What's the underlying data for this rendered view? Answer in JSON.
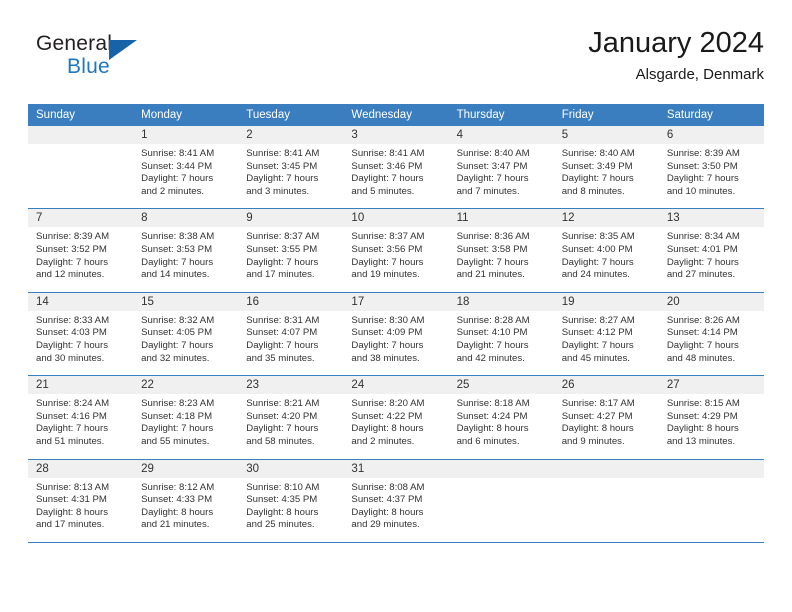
{
  "brand": {
    "name_part1": "General",
    "name_part2": "Blue",
    "triangle_color": "#1863a8",
    "blue_color": "#1f77c2"
  },
  "header": {
    "month_title": "January 2024",
    "location": "Alsgarde, Denmark"
  },
  "theme": {
    "header_bar_color": "#3a7ebf",
    "daynum_band_color": "#f0f0f0",
    "separator_color": "#3a7ebf",
    "text_color": "#333333"
  },
  "labels": {
    "sunrise_prefix": "Sunrise:",
    "sunset_prefix": "Sunset:",
    "daylight_prefix": "Daylight:"
  },
  "weekdays": [
    "Sunday",
    "Monday",
    "Tuesday",
    "Wednesday",
    "Thursday",
    "Friday",
    "Saturday"
  ],
  "weeks": [
    [
      {
        "day": "",
        "empty": true
      },
      {
        "day": "1",
        "sunrise": "Sunrise: 8:41 AM",
        "sunset": "Sunset: 3:44 PM",
        "daylight": "Daylight: 7 hours and 2 minutes."
      },
      {
        "day": "2",
        "sunrise": "Sunrise: 8:41 AM",
        "sunset": "Sunset: 3:45 PM",
        "daylight": "Daylight: 7 hours and 3 minutes."
      },
      {
        "day": "3",
        "sunrise": "Sunrise: 8:41 AM",
        "sunset": "Sunset: 3:46 PM",
        "daylight": "Daylight: 7 hours and 5 minutes."
      },
      {
        "day": "4",
        "sunrise": "Sunrise: 8:40 AM",
        "sunset": "Sunset: 3:47 PM",
        "daylight": "Daylight: 7 hours and 7 minutes."
      },
      {
        "day": "5",
        "sunrise": "Sunrise: 8:40 AM",
        "sunset": "Sunset: 3:49 PM",
        "daylight": "Daylight: 7 hours and 8 minutes."
      },
      {
        "day": "6",
        "sunrise": "Sunrise: 8:39 AM",
        "sunset": "Sunset: 3:50 PM",
        "daylight": "Daylight: 7 hours and 10 minutes."
      }
    ],
    [
      {
        "day": "7",
        "sunrise": "Sunrise: 8:39 AM",
        "sunset": "Sunset: 3:52 PM",
        "daylight": "Daylight: 7 hours and 12 minutes."
      },
      {
        "day": "8",
        "sunrise": "Sunrise: 8:38 AM",
        "sunset": "Sunset: 3:53 PM",
        "daylight": "Daylight: 7 hours and 14 minutes."
      },
      {
        "day": "9",
        "sunrise": "Sunrise: 8:37 AM",
        "sunset": "Sunset: 3:55 PM",
        "daylight": "Daylight: 7 hours and 17 minutes."
      },
      {
        "day": "10",
        "sunrise": "Sunrise: 8:37 AM",
        "sunset": "Sunset: 3:56 PM",
        "daylight": "Daylight: 7 hours and 19 minutes."
      },
      {
        "day": "11",
        "sunrise": "Sunrise: 8:36 AM",
        "sunset": "Sunset: 3:58 PM",
        "daylight": "Daylight: 7 hours and 21 minutes."
      },
      {
        "day": "12",
        "sunrise": "Sunrise: 8:35 AM",
        "sunset": "Sunset: 4:00 PM",
        "daylight": "Daylight: 7 hours and 24 minutes."
      },
      {
        "day": "13",
        "sunrise": "Sunrise: 8:34 AM",
        "sunset": "Sunset: 4:01 PM",
        "daylight": "Daylight: 7 hours and 27 minutes."
      }
    ],
    [
      {
        "day": "14",
        "sunrise": "Sunrise: 8:33 AM",
        "sunset": "Sunset: 4:03 PM",
        "daylight": "Daylight: 7 hours and 30 minutes."
      },
      {
        "day": "15",
        "sunrise": "Sunrise: 8:32 AM",
        "sunset": "Sunset: 4:05 PM",
        "daylight": "Daylight: 7 hours and 32 minutes."
      },
      {
        "day": "16",
        "sunrise": "Sunrise: 8:31 AM",
        "sunset": "Sunset: 4:07 PM",
        "daylight": "Daylight: 7 hours and 35 minutes."
      },
      {
        "day": "17",
        "sunrise": "Sunrise: 8:30 AM",
        "sunset": "Sunset: 4:09 PM",
        "daylight": "Daylight: 7 hours and 38 minutes."
      },
      {
        "day": "18",
        "sunrise": "Sunrise: 8:28 AM",
        "sunset": "Sunset: 4:10 PM",
        "daylight": "Daylight: 7 hours and 42 minutes."
      },
      {
        "day": "19",
        "sunrise": "Sunrise: 8:27 AM",
        "sunset": "Sunset: 4:12 PM",
        "daylight": "Daylight: 7 hours and 45 minutes."
      },
      {
        "day": "20",
        "sunrise": "Sunrise: 8:26 AM",
        "sunset": "Sunset: 4:14 PM",
        "daylight": "Daylight: 7 hours and 48 minutes."
      }
    ],
    [
      {
        "day": "21",
        "sunrise": "Sunrise: 8:24 AM",
        "sunset": "Sunset: 4:16 PM",
        "daylight": "Daylight: 7 hours and 51 minutes."
      },
      {
        "day": "22",
        "sunrise": "Sunrise: 8:23 AM",
        "sunset": "Sunset: 4:18 PM",
        "daylight": "Daylight: 7 hours and 55 minutes."
      },
      {
        "day": "23",
        "sunrise": "Sunrise: 8:21 AM",
        "sunset": "Sunset: 4:20 PM",
        "daylight": "Daylight: 7 hours and 58 minutes."
      },
      {
        "day": "24",
        "sunrise": "Sunrise: 8:20 AM",
        "sunset": "Sunset: 4:22 PM",
        "daylight": "Daylight: 8 hours and 2 minutes."
      },
      {
        "day": "25",
        "sunrise": "Sunrise: 8:18 AM",
        "sunset": "Sunset: 4:24 PM",
        "daylight": "Daylight: 8 hours and 6 minutes."
      },
      {
        "day": "26",
        "sunrise": "Sunrise: 8:17 AM",
        "sunset": "Sunset: 4:27 PM",
        "daylight": "Daylight: 8 hours and 9 minutes."
      },
      {
        "day": "27",
        "sunrise": "Sunrise: 8:15 AM",
        "sunset": "Sunset: 4:29 PM",
        "daylight": "Daylight: 8 hours and 13 minutes."
      }
    ],
    [
      {
        "day": "28",
        "sunrise": "Sunrise: 8:13 AM",
        "sunset": "Sunset: 4:31 PM",
        "daylight": "Daylight: 8 hours and 17 minutes."
      },
      {
        "day": "29",
        "sunrise": "Sunrise: 8:12 AM",
        "sunset": "Sunset: 4:33 PM",
        "daylight": "Daylight: 8 hours and 21 minutes."
      },
      {
        "day": "30",
        "sunrise": "Sunrise: 8:10 AM",
        "sunset": "Sunset: 4:35 PM",
        "daylight": "Daylight: 8 hours and 25 minutes."
      },
      {
        "day": "31",
        "sunrise": "Sunrise: 8:08 AM",
        "sunset": "Sunset: 4:37 PM",
        "daylight": "Daylight: 8 hours and 29 minutes."
      },
      {
        "day": "",
        "empty": true
      },
      {
        "day": "",
        "empty": true
      },
      {
        "day": "",
        "empty": true
      }
    ]
  ]
}
